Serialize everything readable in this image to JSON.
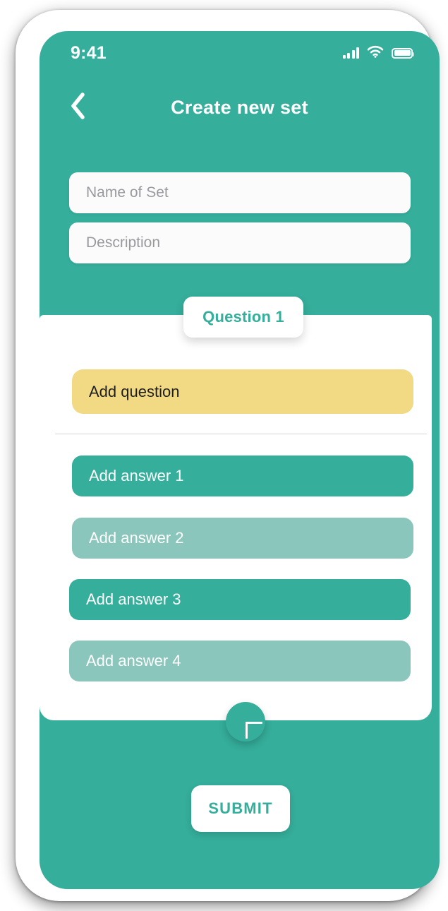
{
  "status_bar": {
    "time": "9:41",
    "signal_icon": "signal-bars-icon",
    "wifi_icon": "wifi-icon",
    "battery_icon": "battery-full-icon"
  },
  "header": {
    "back_icon": "chevron-left-icon",
    "title": "Create new set"
  },
  "form": {
    "name_placeholder": "Name of Set",
    "description_placeholder": "Description"
  },
  "question_card": {
    "tab_label": "Question 1",
    "question_placeholder": "Add question",
    "answers": [
      {
        "placeholder": "Add answer 1",
        "tone": "dark"
      },
      {
        "placeholder": "Add answer 2",
        "tone": "light"
      },
      {
        "placeholder": "Add answer 3",
        "tone": "dark"
      },
      {
        "placeholder": "Add answer 4",
        "tone": "light"
      }
    ]
  },
  "actions": {
    "add_icon": "plus-icon",
    "submit_label": "SUBMIT"
  },
  "colors": {
    "teal": "#35AE9B",
    "teal_light": "#8AC6BC",
    "yellow": "#F2DA84",
    "white": "#FFFFFF",
    "placeholder_gray": "#9A9A9E"
  }
}
